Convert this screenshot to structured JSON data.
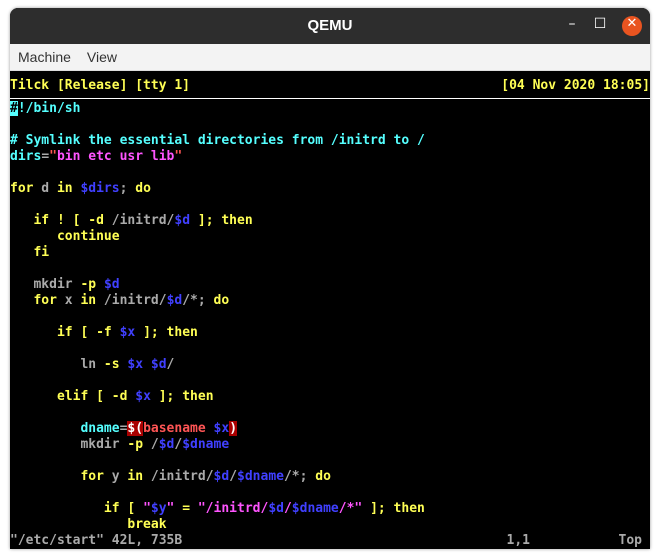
{
  "window": {
    "title": "QEMU",
    "minimize": "–",
    "maximize": "☐",
    "close": "✕"
  },
  "menu": [
    "Machine",
    "View"
  ],
  "terminal": {
    "header_left": "Tilck [Release] [tty 1]",
    "header_right": "[04 Nov 2020 18:05]",
    "colors": {
      "y": "#ffff55",
      "c": "#55ffff",
      "m": "#ff55ff",
      "b": "#4040ff",
      "g": "#aaaaaa",
      "r": "#ff5555",
      "bg": "#000000"
    },
    "lines": [
      [
        [
          "#",
          "cursor"
        ],
        [
          "!/bin/sh",
          "c"
        ]
      ],
      [],
      [
        [
          "# Symlink the essential directories from /initrd to /",
          "c"
        ]
      ],
      [
        [
          "dirs",
          "c"
        ],
        [
          "=",
          "g"
        ],
        [
          "\"",
          "r"
        ],
        [
          "bin etc usr lib",
          "m"
        ],
        [
          "\"",
          "r"
        ]
      ],
      [],
      [
        [
          "for",
          "y"
        ],
        [
          " d ",
          "g"
        ],
        [
          "in",
          "y"
        ],
        [
          " ",
          "g"
        ],
        [
          "$dirs",
          "b"
        ],
        [
          "; ",
          "g"
        ],
        [
          "do",
          "y"
        ]
      ],
      [],
      [
        [
          "   ",
          "g"
        ],
        [
          "if ! [ -d",
          "y"
        ],
        [
          " /initrd/",
          "g"
        ],
        [
          "$d",
          "b"
        ],
        [
          " ]; then",
          "y"
        ]
      ],
      [
        [
          "      continue",
          "y"
        ]
      ],
      [
        [
          "   fi",
          "y"
        ]
      ],
      [],
      [
        [
          "   mkdir ",
          "g"
        ],
        [
          "-p",
          "y"
        ],
        [
          " ",
          "g"
        ],
        [
          "$d",
          "b"
        ]
      ],
      [
        [
          "   ",
          "g"
        ],
        [
          "for",
          "y"
        ],
        [
          " x ",
          "g"
        ],
        [
          "in",
          "y"
        ],
        [
          " /initrd/",
          "g"
        ],
        [
          "$d",
          "b"
        ],
        [
          "/*; ",
          "g"
        ],
        [
          "do",
          "y"
        ]
      ],
      [],
      [
        [
          "      ",
          "g"
        ],
        [
          "if [ -f",
          "y"
        ],
        [
          " ",
          "g"
        ],
        [
          "$x",
          "b"
        ],
        [
          " ]; then",
          "y"
        ]
      ],
      [],
      [
        [
          "         ln ",
          "g"
        ],
        [
          "-s",
          "y"
        ],
        [
          " ",
          "g"
        ],
        [
          "$x",
          "b"
        ],
        [
          " ",
          "g"
        ],
        [
          "$d",
          "b"
        ],
        [
          "/",
          "g"
        ]
      ],
      [],
      [
        [
          "      ",
          "g"
        ],
        [
          "elif [ -d",
          "y"
        ],
        [
          " ",
          "g"
        ],
        [
          "$x",
          "b"
        ],
        [
          " ]; then",
          "y"
        ]
      ],
      [],
      [
        [
          "         ",
          "g"
        ],
        [
          "dname",
          "c"
        ],
        [
          "=",
          "g"
        ],
        [
          "$(",
          "rbw"
        ],
        [
          "basename ",
          "r"
        ],
        [
          "$x",
          "b"
        ],
        [
          ")",
          "rbw"
        ]
      ],
      [
        [
          "         mkdir ",
          "g"
        ],
        [
          "-p",
          "y"
        ],
        [
          " /",
          "g"
        ],
        [
          "$d",
          "b"
        ],
        [
          "/",
          "g"
        ],
        [
          "$dname",
          "b"
        ]
      ],
      [],
      [
        [
          "         ",
          "g"
        ],
        [
          "for",
          "y"
        ],
        [
          " y ",
          "g"
        ],
        [
          "in",
          "y"
        ],
        [
          " /initrd/",
          "g"
        ],
        [
          "$d",
          "b"
        ],
        [
          "/",
          "g"
        ],
        [
          "$dname",
          "b"
        ],
        [
          "/*; ",
          "g"
        ],
        [
          "do",
          "y"
        ]
      ],
      [],
      [
        [
          "            ",
          "g"
        ],
        [
          "if [",
          "y"
        ],
        [
          " ",
          "g"
        ],
        [
          "\"",
          "m"
        ],
        [
          "$y",
          "b"
        ],
        [
          "\"",
          "m"
        ],
        [
          " = ",
          "y"
        ],
        [
          "\"/initrd/",
          "m"
        ],
        [
          "$d",
          "b"
        ],
        [
          "/",
          "m"
        ],
        [
          "$dname",
          "b"
        ],
        [
          "/*\"",
          "m"
        ],
        [
          " ]; then",
          "y"
        ]
      ],
      [
        [
          "               break",
          "y"
        ]
      ]
    ],
    "status_file": "\"/etc/start\" 42L, 735B",
    "status_pos": "1,1",
    "status_scroll": "Top"
  }
}
